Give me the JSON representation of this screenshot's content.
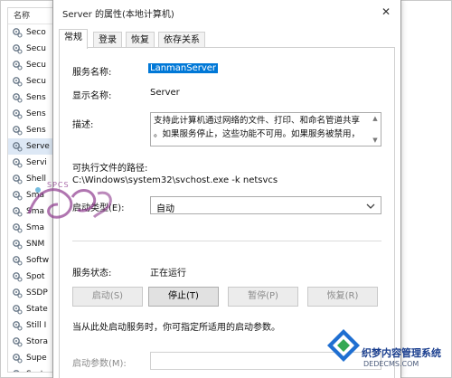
{
  "services_list": {
    "header": "名称",
    "items": [
      "Seco",
      "Secu",
      "Secu",
      "Secu",
      "Sens",
      "Sens",
      "Sens",
      "Serve",
      "Servi",
      "Shell",
      "Sma",
      "Sma",
      "Sma",
      "SNM",
      "Softw",
      "Spot",
      "SSDP",
      "State",
      "Still I",
      "Stora",
      "Supe",
      "Syste"
    ],
    "selected_index": 7
  },
  "dialog": {
    "title": "Server 的属性(本地计算机)",
    "close_glyph": "✕",
    "tabs": [
      "常规",
      "登录",
      "恢复",
      "依存关系"
    ],
    "active_tab": 0,
    "general": {
      "service_name_label": "服务名称:",
      "service_name_value": "LanmanServer",
      "display_name_label": "显示名称:",
      "display_name_value": "Server",
      "description_label": "描述:",
      "description_lines": [
        "支持此计算机通过网络的文件、打印、和命名管道共享",
        "。如果服务停止，这些功能不可用。如果服务被禁用，"
      ],
      "exe_path_label": "可执行文件的路径:",
      "exe_path_value": "C:\\Windows\\system32\\svchost.exe -k netsvcs",
      "startup_type_label": "启动类型(E):",
      "startup_type_value": "自动",
      "service_status_label": "服务状态:",
      "service_status_value": "正在运行",
      "buttons": {
        "start": "启动(S)",
        "stop": "停止(T)",
        "pause": "暂停(P)",
        "resume": "恢复(R)"
      },
      "hint": "当从此处启动服务时，你可指定所适用的启动参数。",
      "start_params_label": "启动参数(M):"
    }
  },
  "watermarks": {
    "left_text": "SPCS",
    "right_line1": "织梦内容管理系统",
    "right_line2": "DEDECMS.COM"
  }
}
